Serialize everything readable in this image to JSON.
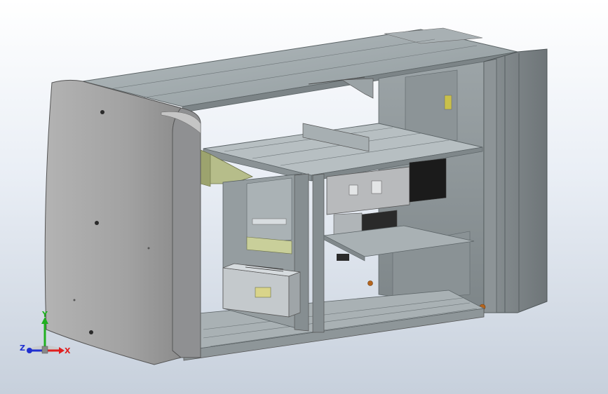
{
  "viewport": {
    "background_top": "#ffffff",
    "background_bottom": "#c7d0dc"
  },
  "triad": {
    "x_label": "X",
    "y_label": "Y",
    "z_label": "Z",
    "x_color": "#e02020",
    "y_color": "#20b020",
    "z_color": "#2030d0"
  },
  "model": {
    "sheet_metal_color": "#9aa3a6",
    "panel_color": "#a5a5a5",
    "bracket_color": "#b6bd8a"
  }
}
